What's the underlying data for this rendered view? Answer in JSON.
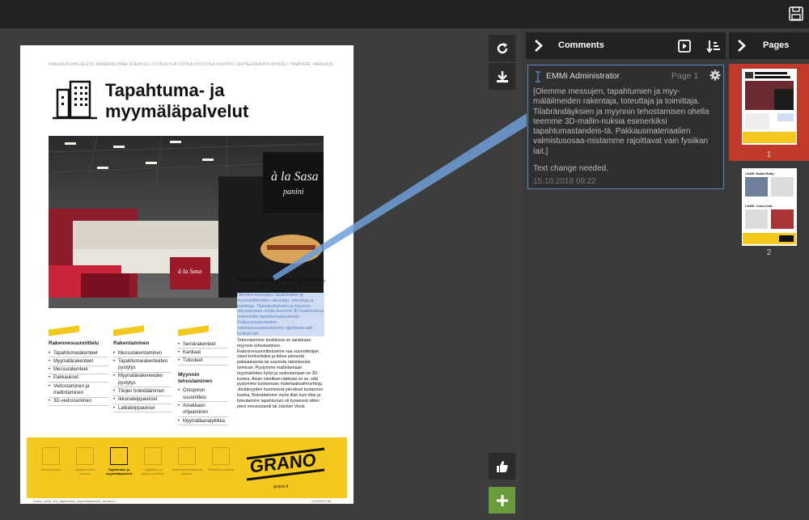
{
  "document": {
    "cities": "PAKKAUPUNKISEUTU HÄMEENLINNA JOENSUU JYVÄSKYLÄ KOTKA KOUVOLA KUOPIO LAPPEENRANTA MIKKELI TAMPERE VARKAUS",
    "title_line1": "Tapahtuma- ja",
    "title_line2": "myymäläpalvelut",
    "sign_text": "à la Sasa panini",
    "caption_head": "Kaikkea mihin fysiikan lait taipuvat.",
    "highlighted_text": "Olemme messujen, tapahtumien ja myymäläilmeiden rakentaja, toteuttaja ja toimittaja. Tilabrändäyksien ja myynnin tehostamisen ohella teemme 3D-mallinnuksia esimerkiksi tapahtumastandeista. Pakkausmateriaalien valmistusosaamistamme rajoittavat vain fysiikan lait.",
    "body_text": "Tekemisemme keskiössä on asiakkaan myynnin tehostaminen. Rakennesuunnittelumme saa suunnittelijan visiot konkretiaksi ja tekee pienestä pakkauksesta tai suuresta rakenteesta toimivan. Pystymme mallintamaan myymälöiden hyllyt ja vedostamaan ne 3D-kuvina. Aivan oleellisen tärkeää on se, että pystymme tuottamaan materiaalivaihtoehtoja -kestävyyden huomioivat piirrokset tuotannon kuvina. Brändäämme myös tilan kuin tilan ja toteutamme tapahtuman oli kyseessä sitten pieni messustandi tai Jukolan Viesti.",
    "columns": [
      {
        "heading": "Rakennesuunnittelu",
        "items": [
          "Tapahtumarakenteet",
          "Myymälärakenteet",
          "Messurakenteet",
          "Pakkaukset",
          "Vedostaminen ja mallintaminen",
          "3D-vedostaminen"
        ]
      },
      {
        "heading": "Rakentaminen",
        "items": [
          "Messurakentaminen",
          "Tapahtumarakenteiden pystytys",
          "Myymälärakenteiden pystytys",
          "Tilojen brändääminen",
          "Ikkunateippaukset",
          "Lattiateippaukset"
        ]
      },
      {
        "heading": "",
        "items": [
          "Seinärakenteet",
          "Kankaat",
          "Tulosteet"
        ]
      },
      {
        "heading": "Myynnin tehostaminen",
        "items": [
          "Ostopolun suunnittelu",
          "Asiakkaan ohjaaminen",
          "Myymäläanalytiikka"
        ]
      }
    ],
    "footer_icons": [
      {
        "label": "Painopalvelut",
        "active": false
      },
      {
        "label": "Markkinoinnin palvelut",
        "active": false
      },
      {
        "label": "Tapahtuma- ja myymäläpalvelut",
        "active": true
      },
      {
        "label": "Logistiikan ja jakelun palvelut",
        "active": false
      },
      {
        "label": "Materiaalienhallinnan palvelut",
        "active": false
      },
      {
        "label": "Sähköiset palvelut",
        "active": false
      }
    ],
    "brand": "GRANO",
    "brand_url": "grano.fi",
    "file_footer": "Grano_tuote_sivi_tapahtuma_myymalapalvelut_a4.indd 1",
    "date_footer": "2.8.2018 0.06"
  },
  "comments": {
    "title": "Comments",
    "author": "EMMi Administrator",
    "page_label": "Page 1",
    "body": "[Olemme messujen, tapahtumien ja myy-mäläilmeiden rakentaja, toteuttaja ja toimittaja. Tilabrändäyksien ja myynnin tehostamisen ohella teemme 3D-mallin-nuksia esimerkiksi tapahtumastandeis-tä. Pakkausmateriaalien valmistusosaa-mistamme rajoittavat vain fysiikan lait.]",
    "note": "Text change needed.",
    "date": "15.10.2018 09:22"
  },
  "pages": {
    "title": "Pages",
    "thumbs": [
      {
        "number": "1",
        "selected": true
      },
      {
        "number": "2",
        "selected": false
      }
    ],
    "thumb2_labels": [
      "CASE: Nokia Ruby",
      "CASE: Coca-Cola"
    ]
  },
  "colors": {
    "accent_yellow": "#f5c81f",
    "highlight_blue": "#5b86c2",
    "selected_red": "#c0392b",
    "approve_green": "#6a9b3c"
  }
}
